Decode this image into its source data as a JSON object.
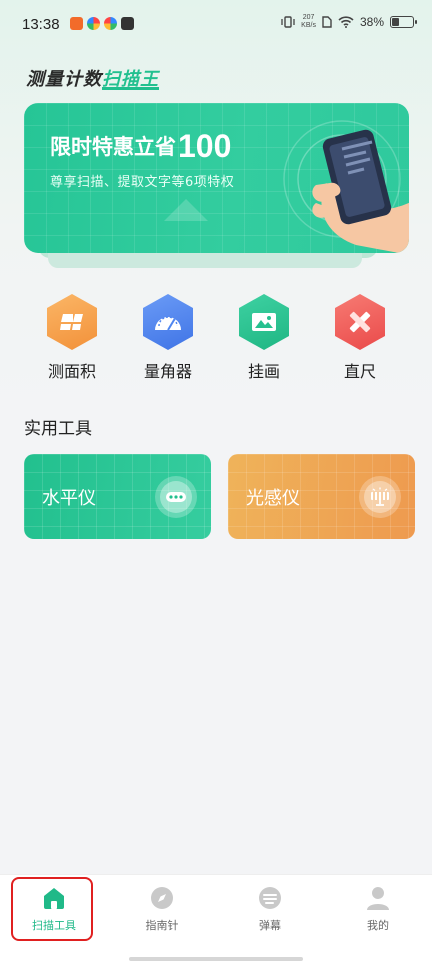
{
  "status_bar": {
    "time": "13:38",
    "net_speed_value": "207",
    "net_speed_unit": "KB/s",
    "battery_percent": "38%",
    "battery_level": 0.38
  },
  "app": {
    "title_prefix": "测量计数",
    "title_accent": "扫描王"
  },
  "banner": {
    "headline": "限时特惠立省",
    "headline_number": "100",
    "subtitle": "尊享扫描、提取文字等6项特权"
  },
  "tools": [
    {
      "label": "测面积",
      "icon": "area-icon",
      "color": "#f6a24c"
    },
    {
      "label": "量角器",
      "icon": "protractor-icon",
      "color": "#4f86f0"
    },
    {
      "label": "挂画",
      "icon": "picture-icon",
      "color": "#27c08f"
    },
    {
      "label": "直尺",
      "icon": "ruler-icon",
      "color": "#f2625e"
    }
  ],
  "practical": {
    "title": "实用工具",
    "cards": [
      {
        "label": "水平仪",
        "icon": "level-icon",
        "color": "#23c18f"
      },
      {
        "label": "光感仪",
        "icon": "light-meter-icon",
        "color": "#f0a24e"
      }
    ]
  },
  "bottom_nav": [
    {
      "label": "扫描工具",
      "icon": "home-icon",
      "active": true
    },
    {
      "label": "指南针",
      "icon": "compass-icon",
      "active": false
    },
    {
      "label": "弹幕",
      "icon": "danmaku-icon",
      "active": false
    },
    {
      "label": "我的",
      "icon": "profile-icon",
      "active": false
    }
  ],
  "colors": {
    "accent": "#20b988",
    "highlight_box": "#e02020"
  }
}
